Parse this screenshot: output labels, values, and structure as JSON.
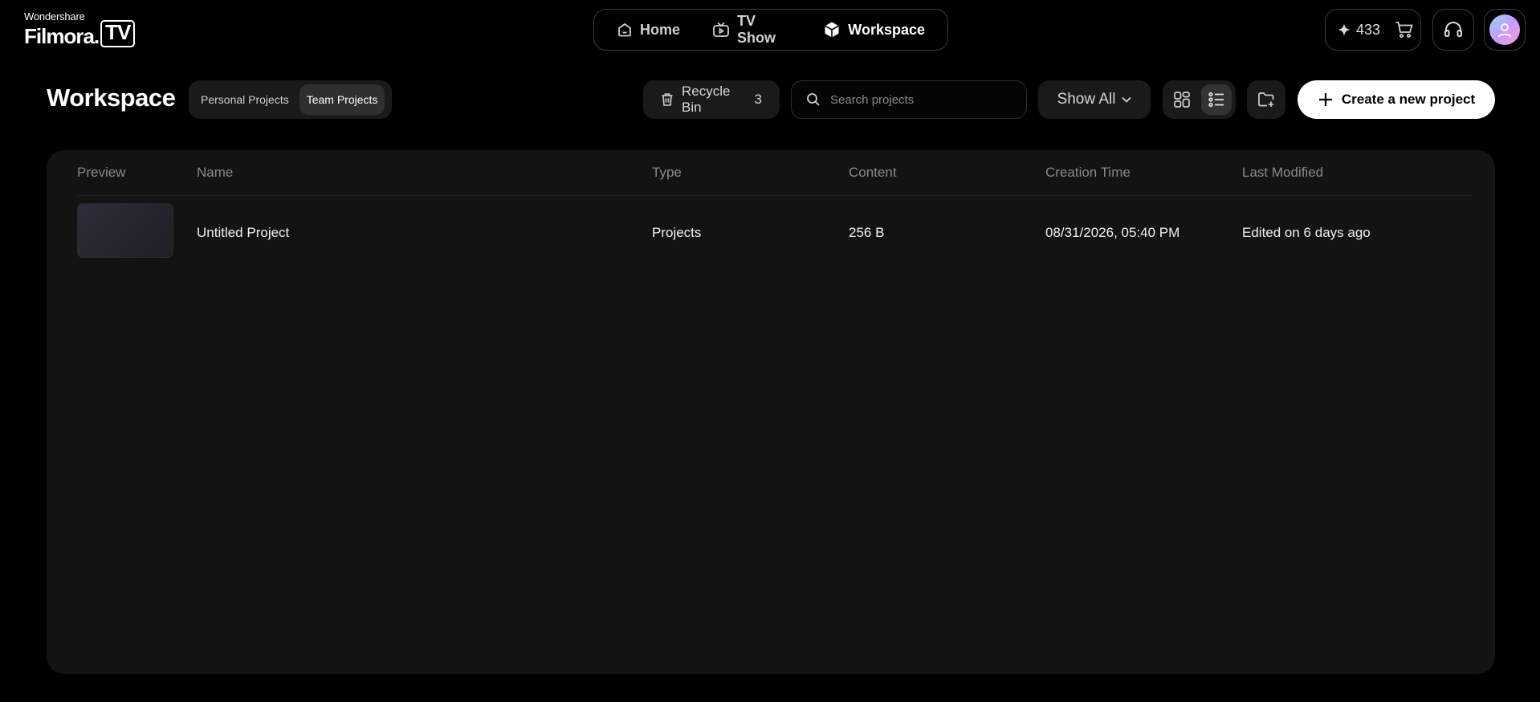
{
  "logo": {
    "brand": "Wondershare",
    "product_main": "Filmora.",
    "product_box": "TV"
  },
  "nav": [
    {
      "label": "Home",
      "icon": "home-icon",
      "active": false
    },
    {
      "label": "TV Show",
      "icon": "tv-icon",
      "active": false
    },
    {
      "label": "Workspace",
      "icon": "cube-icon",
      "active": true
    }
  ],
  "credits": {
    "count": "433"
  },
  "workspace": {
    "title": "Workspace",
    "tabs": [
      {
        "label": "Personal Projects",
        "active": false
      },
      {
        "label": "Team Projects",
        "active": true
      }
    ],
    "recycle_label": "Recycle Bin",
    "recycle_count": "3",
    "search_placeholder": "Search projects",
    "filter_label": "Show All",
    "create_label": "Create a new project"
  },
  "table": {
    "columns": [
      "Preview",
      "Name",
      "Type",
      "Content",
      "Creation Time",
      "Last Modified"
    ],
    "rows": [
      {
        "name": "Untitled Project",
        "type": "Projects",
        "content": "256 B",
        "created": "08/31/2026, 05:40 PM",
        "modified": "Edited on 6 days ago"
      }
    ]
  },
  "colors": {
    "background": "#000000",
    "panel": "#131313",
    "accent": "#ffffff"
  }
}
